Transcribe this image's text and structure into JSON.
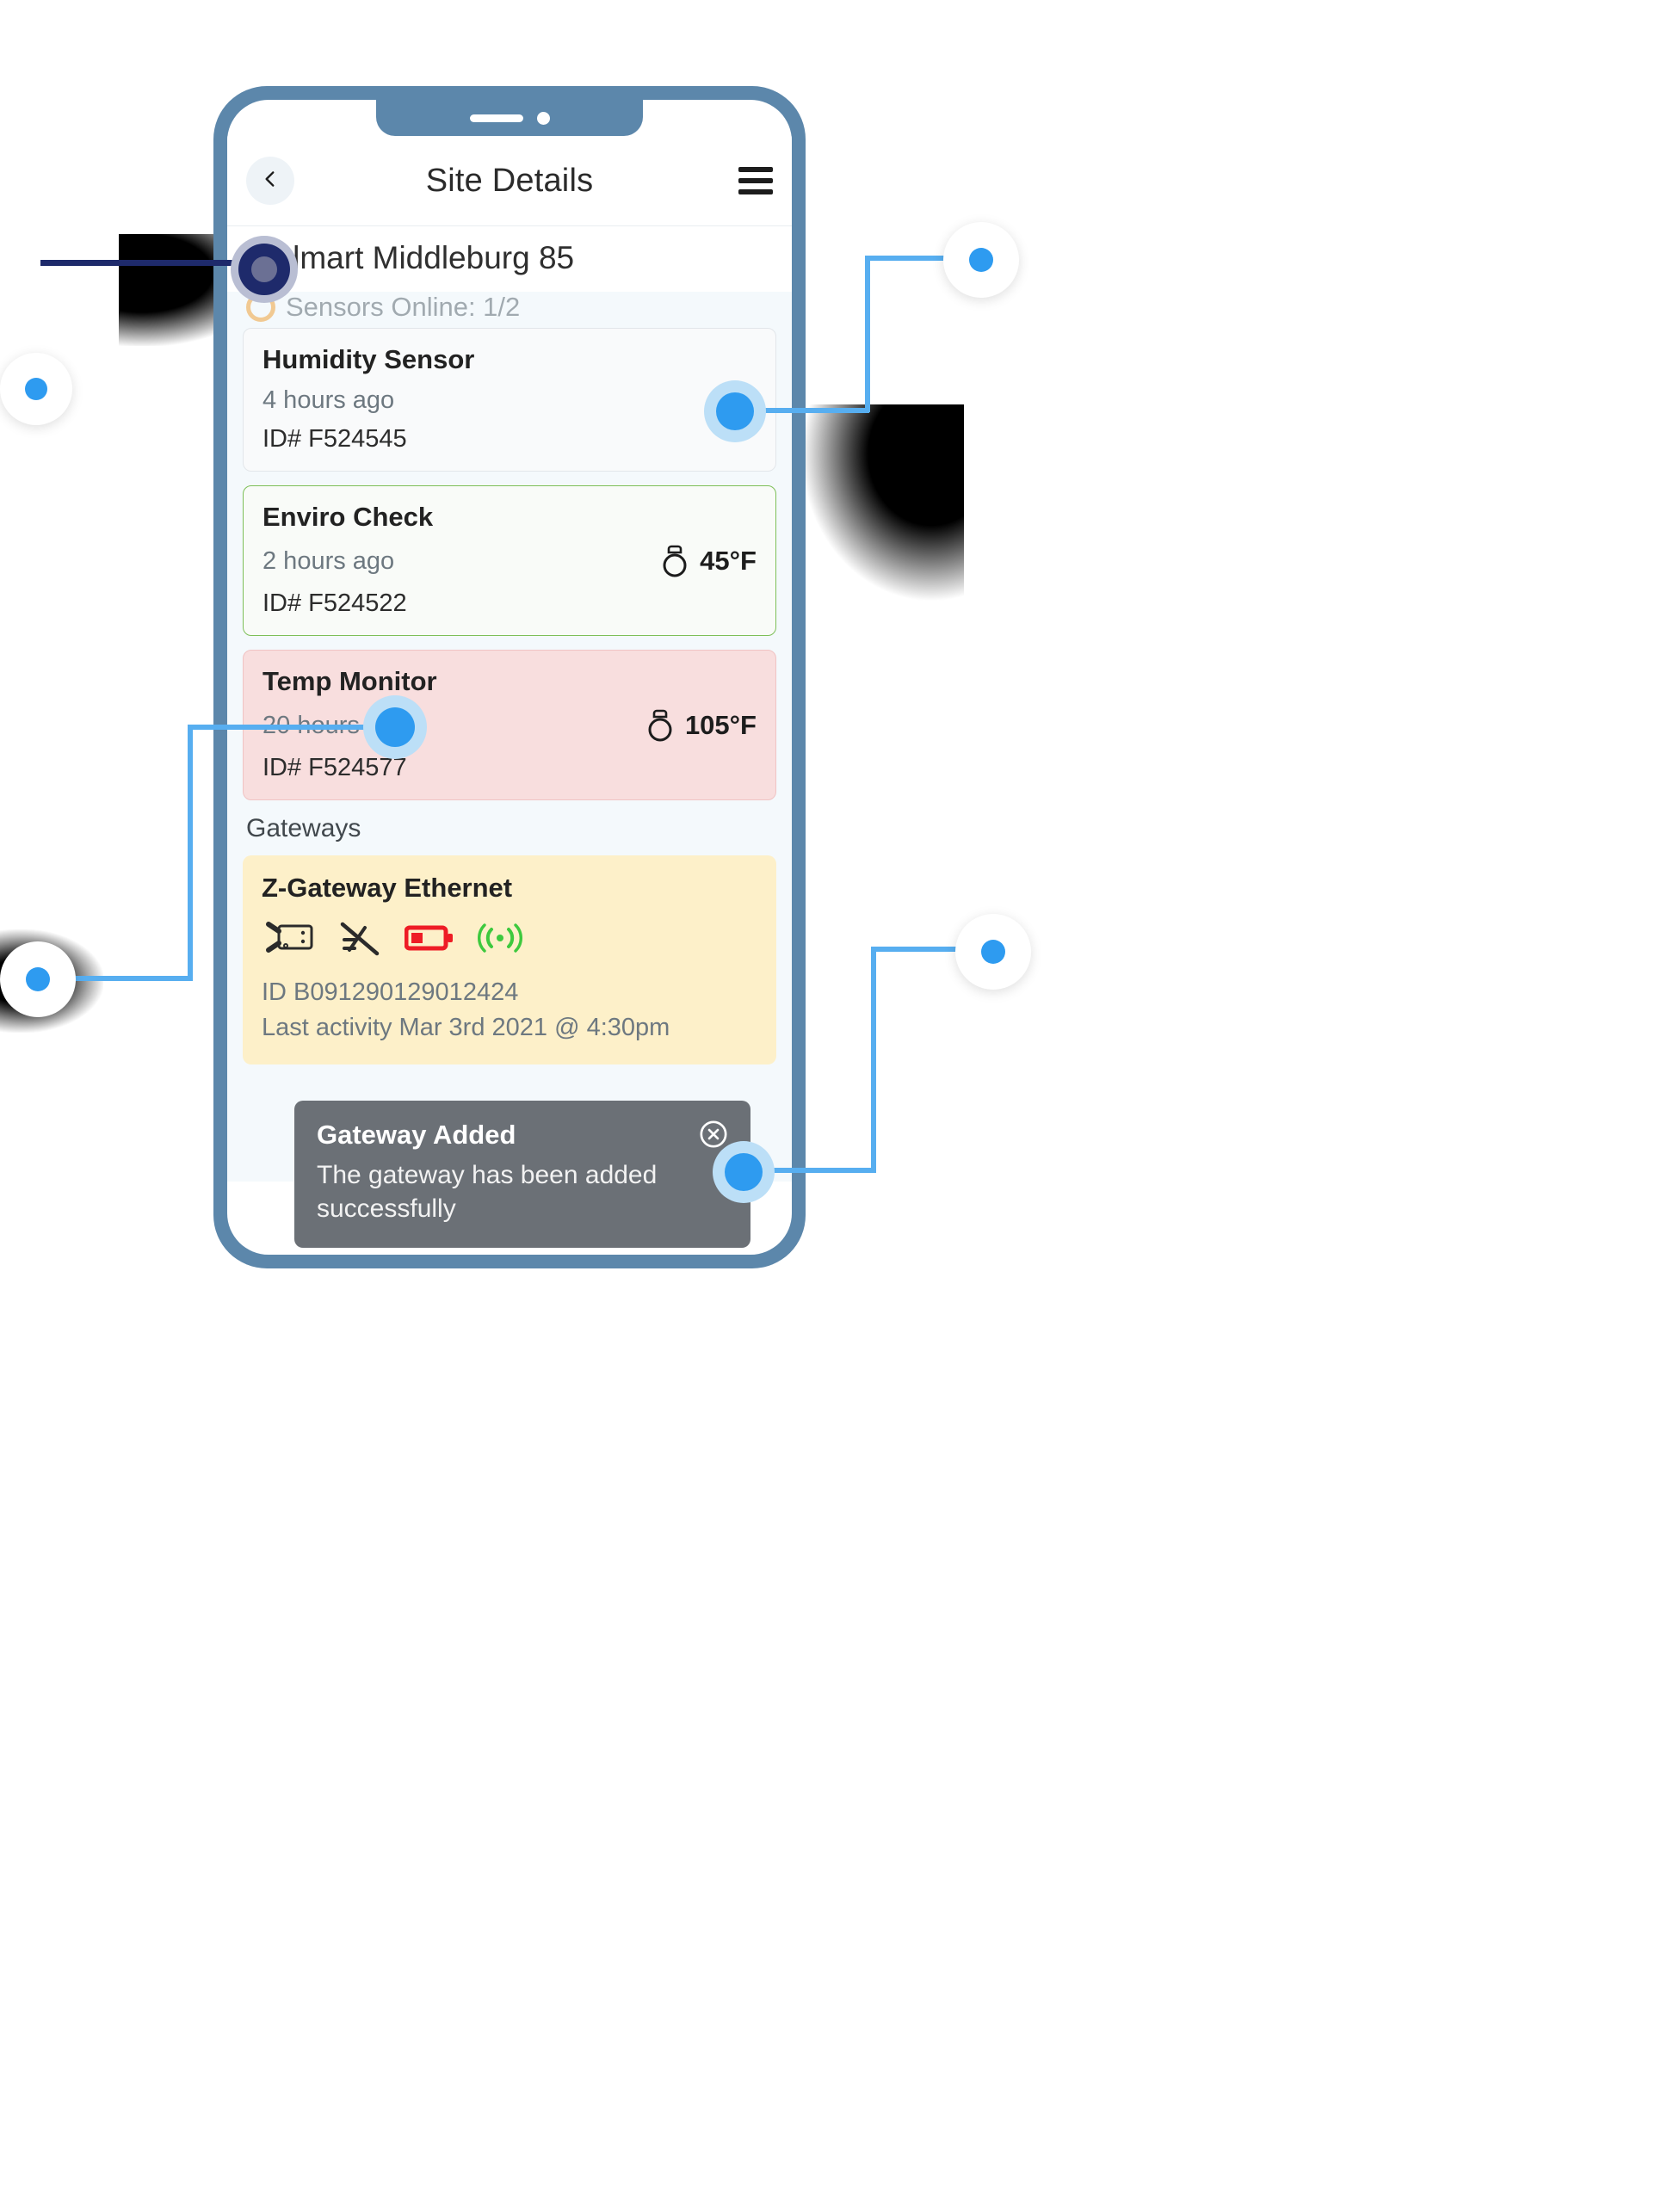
{
  "app": {
    "title": "Site Details",
    "back_icon": "chevron-left-icon",
    "menu_icon": "hamburger-menu-icon",
    "site_name": "Walmart Middleburg 85",
    "sensors_online": "Sensors Online: 1/2",
    "status_ring_color": "#f0a33c"
  },
  "sensors": [
    {
      "name": "Humidity Sensor",
      "time": "4 hours ago",
      "id": "ID# F524545",
      "reading": "",
      "state": "neutral",
      "icon": "humidity-sensor-icon"
    },
    {
      "name": "Enviro Check",
      "time": "2 hours ago",
      "id": "ID# F524522",
      "reading": "45°F",
      "state": "ok",
      "icon": "thermometer-icon"
    },
    {
      "name": "Temp Monitor",
      "time": "20 hours ago",
      "id": "ID# F524577",
      "reading": "105°F",
      "state": "alert",
      "icon": "thermometer-icon"
    }
  ],
  "gateways": {
    "section_label": "Gateways",
    "card": {
      "title": "Z-Gateway Ethernet",
      "id": "ID B091290129012424",
      "last_activity": "Last activity Mar 3rd 2021 @ 4:30pm",
      "icons": [
        "ethernet-plug-icon",
        "antenna-disabled-icon",
        "battery-low-icon",
        "signal-broadcast-icon"
      ],
      "battery_color": "#ee1c25",
      "signal_color": "#3ec93e",
      "background_color": "#fdf0c9"
    }
  },
  "toast": {
    "title": "Gateway Added",
    "message": "The gateway has been added successfully",
    "close_icon": "close-circle-icon",
    "background_color": "#6b7076"
  },
  "annotations": {
    "accent_color": "#2e9bf0",
    "dark_color": "#1e2a6b",
    "callouts": [
      {
        "name": "callout-site-name",
        "variant": "dark"
      },
      {
        "name": "callout-sensor-icon",
        "variant": "light"
      },
      {
        "name": "callout-temp-monitor",
        "variant": "light"
      },
      {
        "name": "callout-gateway-icons",
        "variant": "light"
      },
      {
        "name": "callout-toast",
        "variant": "light"
      }
    ]
  },
  "phone": {
    "frame_color": "#5c87ab"
  }
}
